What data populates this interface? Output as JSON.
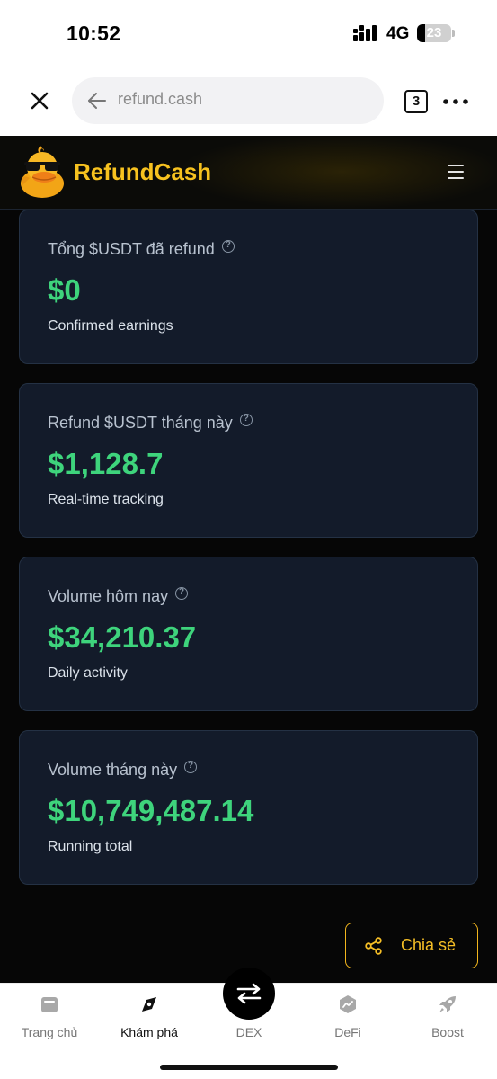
{
  "status_bar": {
    "time": "10:52",
    "network": "4G",
    "battery": "23",
    "battery_level": 0.23
  },
  "browser": {
    "url": "refund.cash",
    "tab_count": "3"
  },
  "site": {
    "brand": "RefundCash",
    "brand_color": "#f7c21f"
  },
  "stats": [
    {
      "label": "Tổng $USDT đã refund",
      "value": "$0",
      "sub": "Confirmed earnings"
    },
    {
      "label": "Refund $USDT tháng này",
      "value": "$1,128.7",
      "sub": "Real-time tracking"
    },
    {
      "label": "Volume hôm nay",
      "value": "$34,210.37",
      "sub": "Daily activity"
    },
    {
      "label": "Volume tháng này",
      "value": "$10,749,487.14",
      "sub": "Running total"
    }
  ],
  "share_label": "Chia sẻ",
  "nav": {
    "items": [
      {
        "label": "Trang chủ",
        "icon": "wallet-icon"
      },
      {
        "label": "Khám phá",
        "icon": "compass-icon",
        "active": true
      },
      {
        "label": "DEX",
        "icon": "swap-arrows-icon"
      },
      {
        "label": "DeFi",
        "icon": "defi-chart-icon"
      },
      {
        "label": "Boost",
        "icon": "rocket-icon"
      }
    ]
  },
  "colors": {
    "accent_green": "#3ed47c",
    "accent_gold": "#f6bf26",
    "card_bg": "#131b2a"
  }
}
